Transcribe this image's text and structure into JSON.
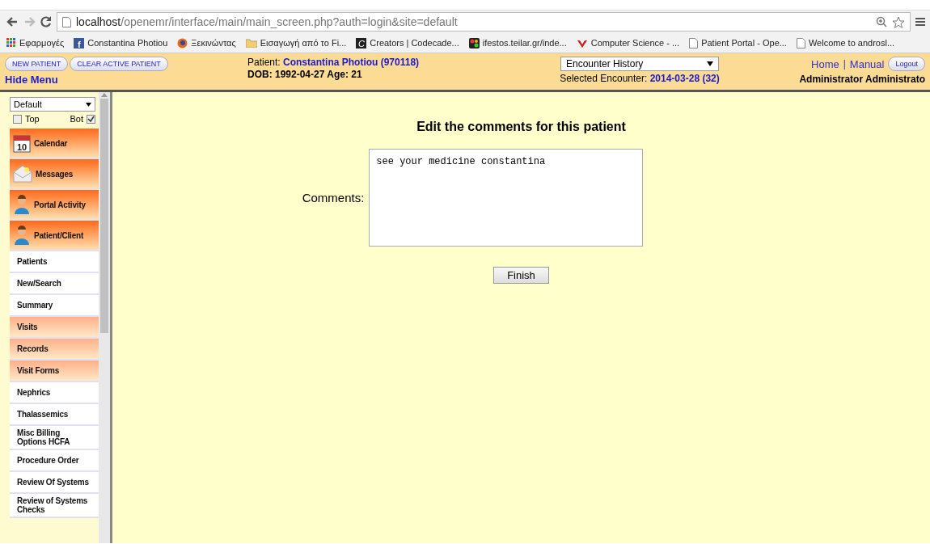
{
  "browser": {
    "url_host": "localhost",
    "url_path": "/openemr/interface/main/main_screen.php?auth=login&site=default",
    "bookmarks": [
      {
        "kind": "grid",
        "label": "Εφαρμογές"
      },
      {
        "kind": "letter",
        "letter": "f",
        "label": "Constantina Photiou"
      },
      {
        "kind": "globe",
        "label": "Ξεκινώντας"
      },
      {
        "kind": "folder",
        "label": "Εισαγωγή από το Fi..."
      },
      {
        "kind": "tile",
        "letter": "C",
        "label": "Creators | Codecade..."
      },
      {
        "kind": "puzzle",
        "label": "ifestos.teilar.gr/inde..."
      },
      {
        "kind": "check",
        "label": "Computer Science - ..."
      },
      {
        "kind": "page",
        "label": "Patient Portal - Ope..."
      },
      {
        "kind": "page",
        "label": "Welcome to androsl..."
      }
    ]
  },
  "header": {
    "buttons": [
      "NEW PATIENT",
      "CLEAR ACTIVE PATIENT"
    ],
    "hide_menu": "Hide Menu",
    "patient_label": "Patient:",
    "patient_name": "Constantina Photiou (970118)",
    "dob": "DOB: 1992-04-27 Age: 21",
    "encounter_select": "Encounter History",
    "encounter_label": "Selected Encounter:",
    "encounter_value": "2014-03-28 (32)",
    "links": [
      "Home",
      "Manual"
    ],
    "separator": "|",
    "logout": "Logout",
    "user": "Administrator Administrato"
  },
  "sidebar": {
    "layout_select": "Default",
    "checkboxes": [
      {
        "label": "Top",
        "checked": false
      },
      {
        "label": "Bot",
        "checked": true
      }
    ],
    "items": [
      {
        "kind": "calendar",
        "label": "Calendar",
        "calendar_day": "10"
      },
      {
        "kind": "mail",
        "label": "Messages"
      },
      {
        "kind": "person",
        "label": "Portal Activity"
      },
      {
        "kind": "person",
        "label": "Patient/Client"
      },
      {
        "kind": "link",
        "label": "Patients"
      },
      {
        "kind": "link",
        "label": "New/Search"
      },
      {
        "kind": "link",
        "label": "Summary"
      },
      {
        "kind": "section",
        "label": "Visits"
      },
      {
        "kind": "section",
        "label": "Records"
      },
      {
        "kind": "section",
        "label": "Visit Forms"
      },
      {
        "kind": "link",
        "label": "Nephrics"
      },
      {
        "kind": "link",
        "label": "Thalassemics"
      },
      {
        "kind": "link",
        "label": "Misc Billing Options HCFA"
      },
      {
        "kind": "link",
        "label": "Procedure Order"
      },
      {
        "kind": "link",
        "label": "Review Of Systems"
      },
      {
        "kind": "link",
        "label": "Review of Systems Checks"
      }
    ]
  },
  "content": {
    "title": "Edit the comments for this patient",
    "comments_label": "Comments:",
    "comments_value": "see your medicine constantina",
    "finish": "Finish"
  }
}
